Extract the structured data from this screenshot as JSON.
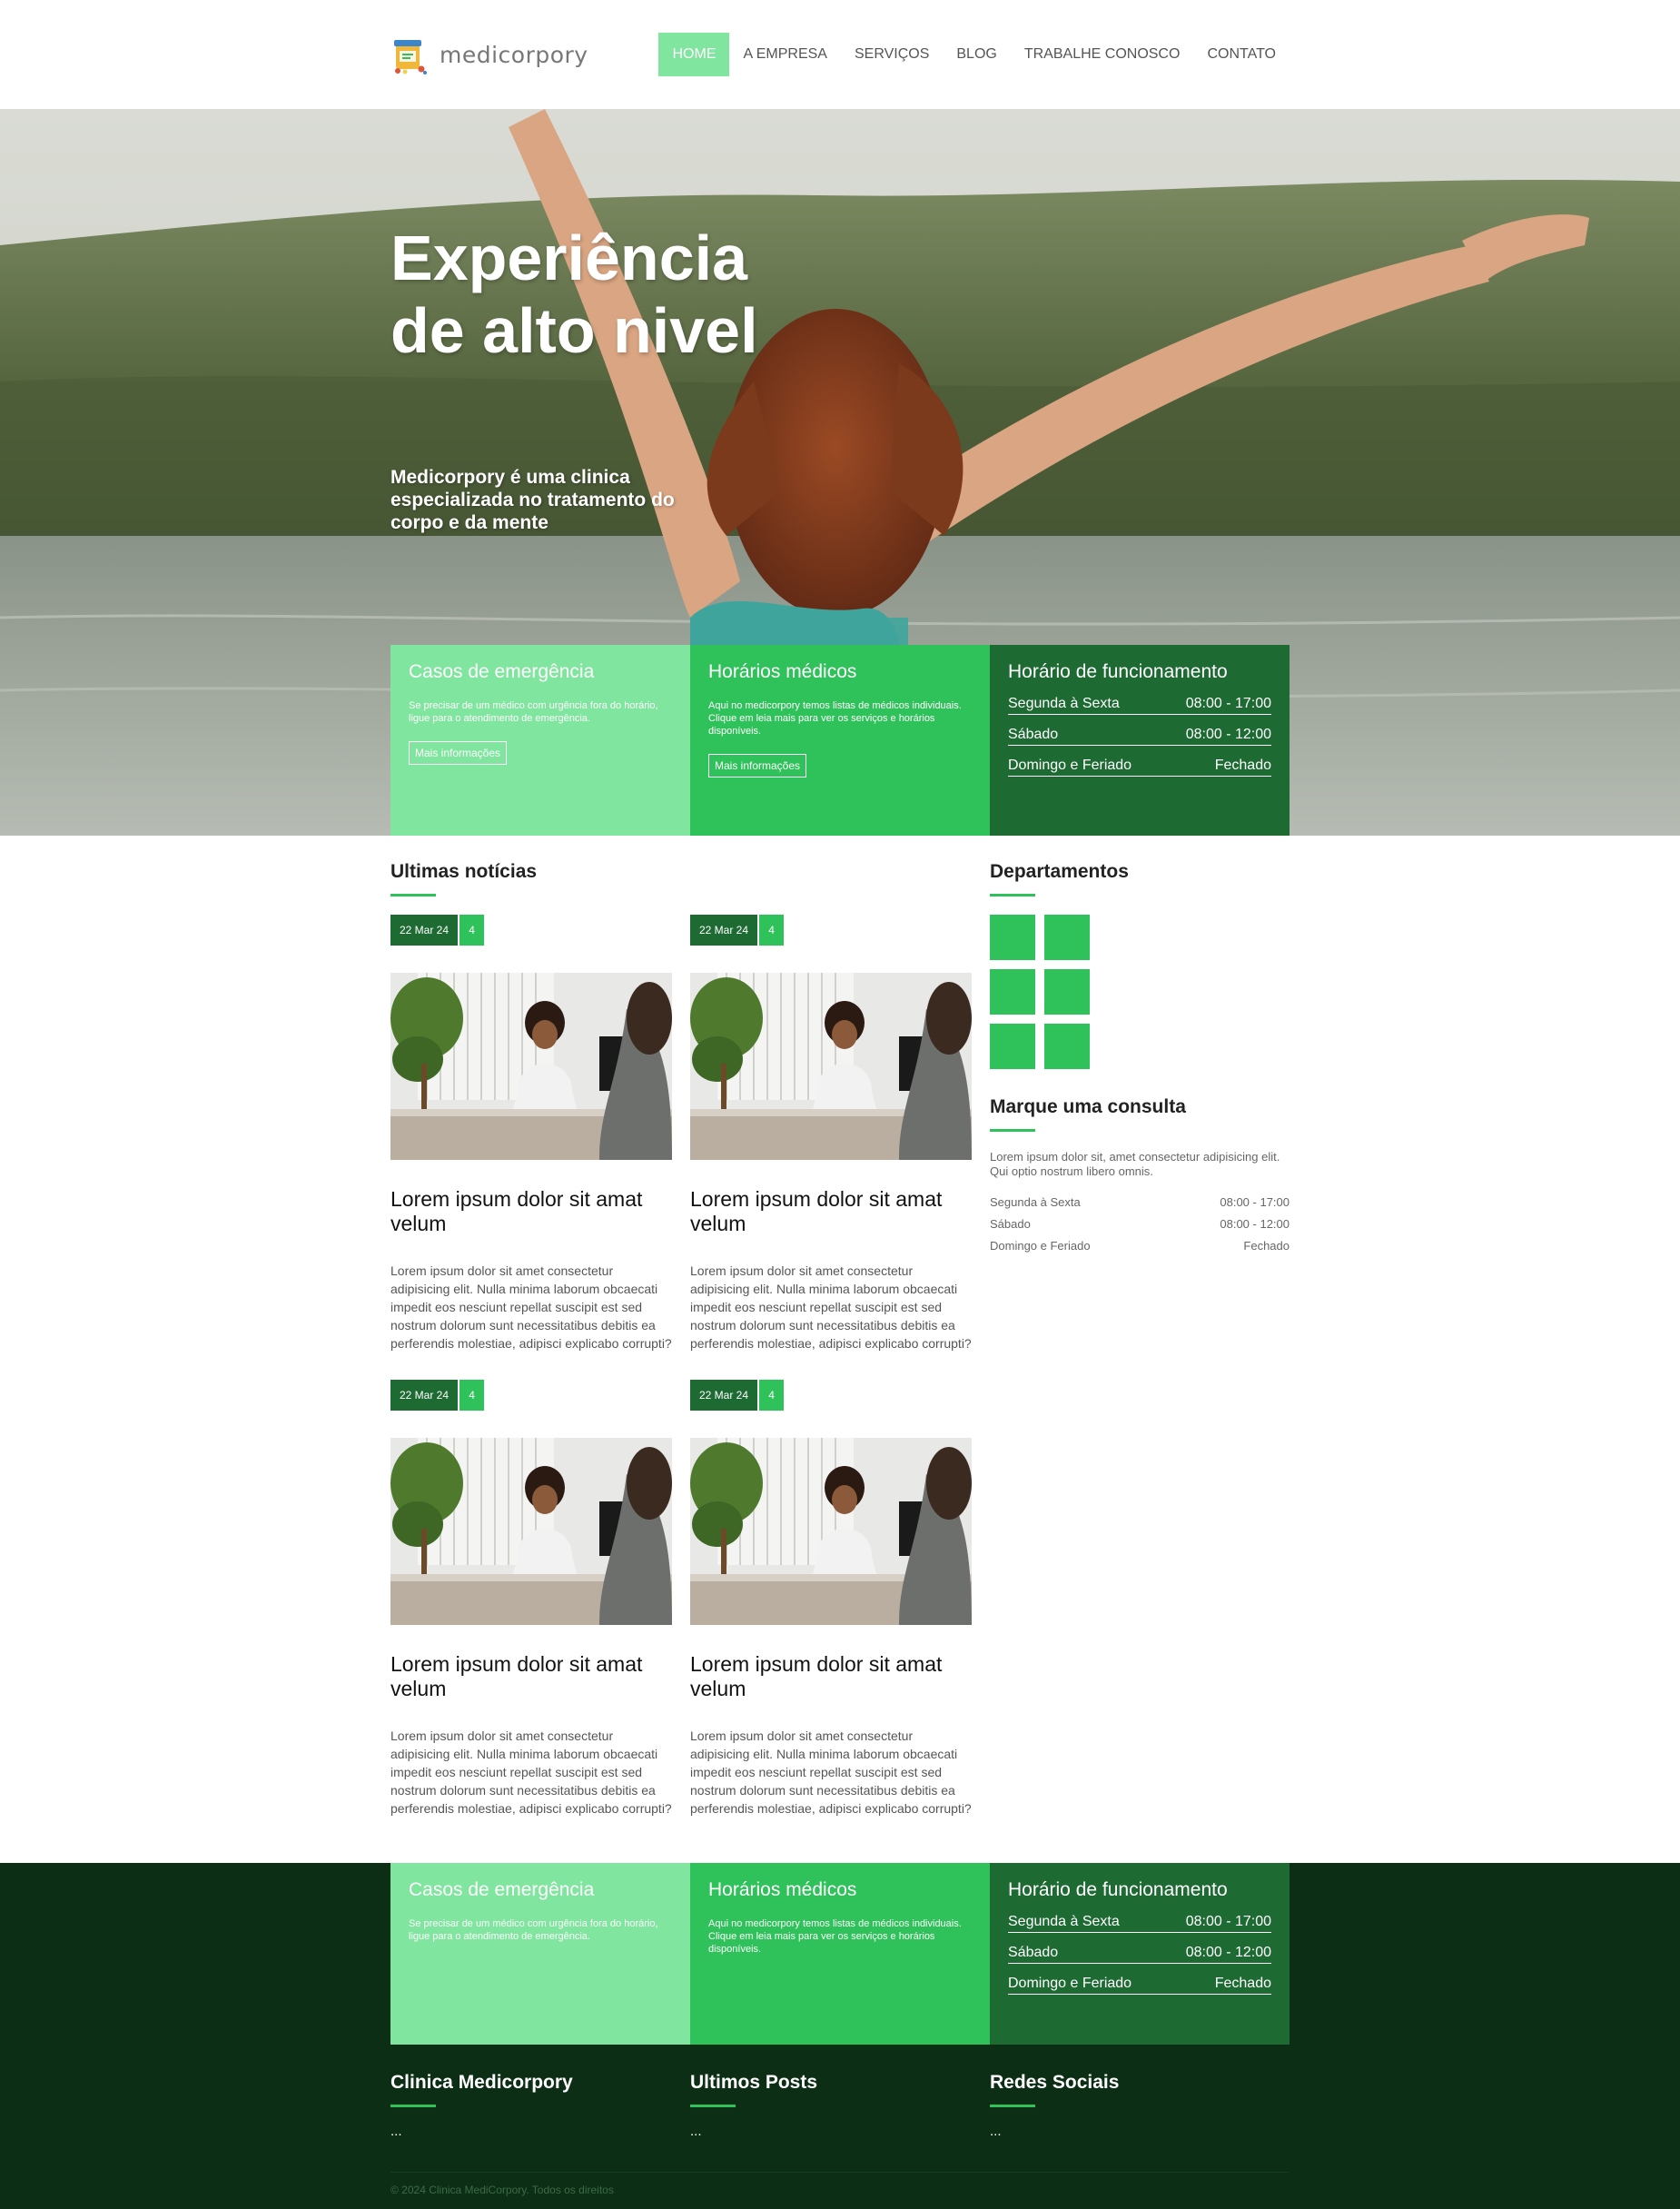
{
  "brand": {
    "name": "medicorpory",
    "colors": {
      "light_green": "#80e59e",
      "green": "#2fc15a",
      "dark_green": "#1d6a33",
      "footer_bg": "#0b2e14"
    }
  },
  "nav": {
    "items": [
      {
        "label": "HOME",
        "active": true
      },
      {
        "label": "A EMPRESA",
        "active": false
      },
      {
        "label": "SERVIÇOS",
        "active": false
      },
      {
        "label": "BLOG",
        "active": false
      },
      {
        "label": "TRABALHE CONOSCO",
        "active": false
      },
      {
        "label": "CONTATO",
        "active": false
      }
    ]
  },
  "hero": {
    "title": "Experiência de alto nivel",
    "subtitle": "Medicorpory é uma clinica especializada no tratamento do corpo e da mente",
    "image_icon": "woman-arms-raised-photo"
  },
  "info": {
    "emergency": {
      "title": "Casos de emergência",
      "text": "Se precisar de um médico com urgência fora do horário, ligue para o atendimento de emergência.",
      "button": "Mais informações"
    },
    "schedules": {
      "title": "Horários médicos",
      "text": "Aqui no medicorpory temos listas de médicos individuais. Clique em leia mais para ver os serviços e horários disponíveis.",
      "button": "Mais informações"
    },
    "hours": {
      "title": "Horário de funcionamento",
      "rows": [
        {
          "day": "Segunda à Sexta",
          "time": "08:00 - 17:00"
        },
        {
          "day": "Sábado",
          "time": "08:00 - 12:00"
        },
        {
          "day": "Domingo e Feriado",
          "time": "Fechado"
        }
      ]
    }
  },
  "news": {
    "title": "Ultimas notícias",
    "posts": [
      {
        "date": "22 Mar 24",
        "count": "4",
        "title": "Lorem ipsum dolor sit amat velum",
        "text": "Lorem ipsum dolor sit amet consectetur adipisicing elit. Nulla minima laborum obcaecati impedit eos nesciunt repellat suscipit est sed nostrum dolorum sunt necessitatibus debitis ea perferendis molestiae, adipisci explicabo corrupti?"
      },
      {
        "date": "22 Mar 24",
        "count": "4",
        "title": "Lorem ipsum dolor sit amat velum",
        "text": "Lorem ipsum dolor sit amet consectetur adipisicing elit. Nulla minima laborum obcaecati impedit eos nesciunt repellat suscipit est sed nostrum dolorum sunt necessitatibus debitis ea perferendis molestiae, adipisci explicabo corrupti?"
      },
      {
        "date": "22 Mar 24",
        "count": "4",
        "title": "Lorem ipsum dolor sit amat velum",
        "text": "Lorem ipsum dolor sit amet consectetur adipisicing elit. Nulla minima laborum obcaecati impedit eos nesciunt repellat suscipit est sed nostrum dolorum sunt necessitatibus debitis ea perferendis molestiae, adipisci explicabo corrupti?"
      },
      {
        "date": "22 Mar 24",
        "count": "4",
        "title": "Lorem ipsum dolor sit amat velum",
        "text": "Lorem ipsum dolor sit amet consectetur adipisicing elit. Nulla minima laborum obcaecati impedit eos nesciunt repellat suscipit est sed nostrum dolorum sunt necessitatibus debitis ea perferendis molestiae, adipisci explicabo corrupti?"
      }
    ]
  },
  "sidebar": {
    "departments_title": "Departamentos",
    "consult": {
      "title": "Marque uma consulta",
      "text": "Lorem ipsum dolor sit, amet consectetur adipisicing elit. Qui optio nostrum libero omnis.",
      "rows": [
        {
          "day": "Segunda à Sexta",
          "time": "08:00 - 17:00"
        },
        {
          "day": "Sábado",
          "time": "08:00 - 12:00"
        },
        {
          "day": "Domingo e Feriado",
          "time": "Fechado"
        }
      ]
    }
  },
  "footer": {
    "cols": [
      {
        "title": "Clinica Medicorpory",
        "text": "..."
      },
      {
        "title": "Ultimos Posts",
        "text": "..."
      },
      {
        "title": "Redes Sociais",
        "text": "..."
      }
    ],
    "copyright": "© 2024 Clinica MediCorpory. Todos os direitos"
  }
}
